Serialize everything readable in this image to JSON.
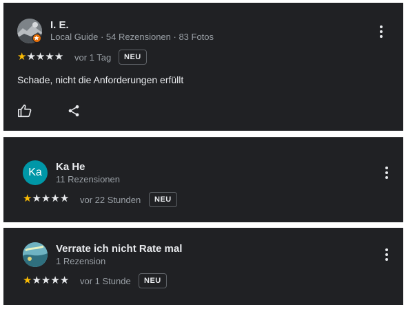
{
  "reviews": [
    {
      "avatar_icon": "profile-photo",
      "name": "I. E.",
      "subtitle": "Local Guide · 54 Rezensionen · 83 Fotos",
      "rating": 1,
      "max_rating": 5,
      "stars_text": "★★★★★",
      "time": "vor 1 Tag",
      "badge": "NEU",
      "text": "Schade, nicht die Anforderungen erfüllt",
      "actions": [
        "thumbs-up-icon",
        "share-icon"
      ]
    },
    {
      "avatar_letters": "Ka",
      "avatar_color": "#0097a7",
      "name": "Ka He",
      "subtitle": "11 Rezensionen",
      "rating": 1,
      "max_rating": 5,
      "time": "vor 22 Stunden",
      "badge": "NEU"
    },
    {
      "avatar_icon": "profile-photo",
      "name": "Verrate ich nicht Rate mal",
      "subtitle": "1 Rezension",
      "rating": 1,
      "max_rating": 5,
      "time": "vor 1 Stunde",
      "badge": "NEU"
    }
  ],
  "colors": {
    "card_background": "#202124",
    "star_filled": "#fbbc04",
    "star_empty": "#e8eaed",
    "secondary_text": "#9aa0a6",
    "local_guide_badge": "#e8710a"
  }
}
